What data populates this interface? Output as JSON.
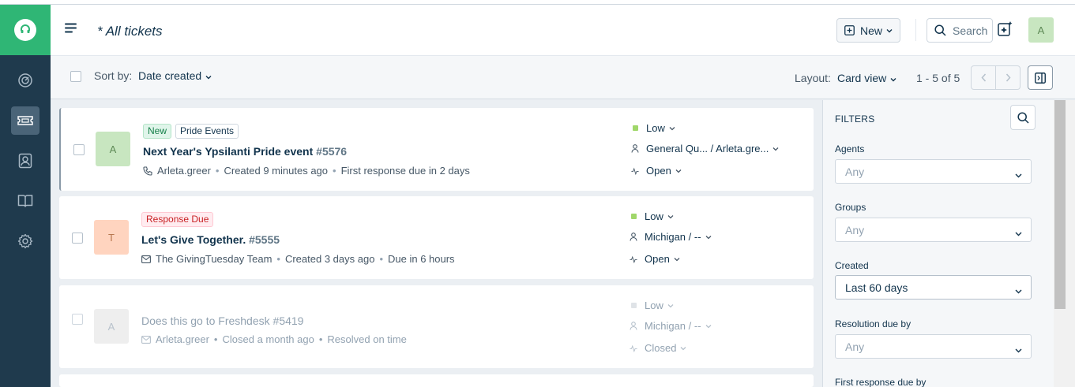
{
  "header": {
    "title": "* All tickets",
    "new_label": "New",
    "search_label": "Search",
    "avatar_initial": "A"
  },
  "toolbar": {
    "sort_label": "Sort by:",
    "sort_value": "Date created",
    "layout_label": "Layout:",
    "layout_value": "Card view",
    "page_count": "1 - 5 of 5"
  },
  "tickets": [
    {
      "avatar": "A",
      "tags": [
        "New",
        "Pride Events"
      ],
      "subject": "Next Year's Ypsilanti Pride event",
      "number": "#5576",
      "requester": "Arleta.greer",
      "created": "Created 9 minutes ago",
      "due": "First response due in 2 days",
      "priority": "Low",
      "assignee": "General Qu... / Arleta.gre...",
      "status": "Open"
    },
    {
      "avatar": "T",
      "tags": [
        "Response Due"
      ],
      "subject": "Let's Give Together.",
      "number": "#5555",
      "requester": "The GivingTuesday Team",
      "created": "Created 3 days ago",
      "due": "Due in 6 hours",
      "priority": "Low",
      "assignee": "Michigan / --",
      "status": "Open"
    },
    {
      "avatar": "A",
      "tags": [],
      "subject": "Does this go to Freshdesk",
      "number": "#5419",
      "requester": "Arleta.greer",
      "created": "Closed a month ago",
      "due": "Resolved on time",
      "priority": "Low",
      "assignee": "Michigan / --",
      "status": "Closed"
    }
  ],
  "filters": {
    "title": "FILTERS",
    "agents_label": "Agents",
    "agents_value": "Any",
    "groups_label": "Groups",
    "groups_value": "Any",
    "created_label": "Created",
    "created_value": "Last 60 days",
    "resolution_label": "Resolution due by",
    "resolution_value": "Any",
    "first_response_label": "First response due by"
  },
  "colors": {
    "brand": "#2fb675",
    "sidebar": "#1f3a4d",
    "priority_low": "#a0d76a"
  }
}
